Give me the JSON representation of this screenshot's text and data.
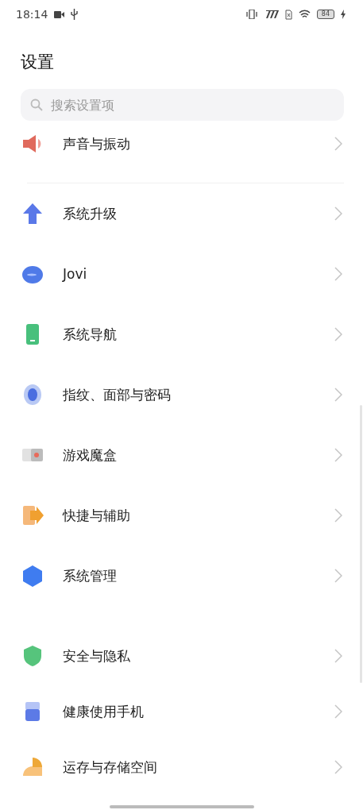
{
  "status_bar": {
    "time": "18:14",
    "battery": "84"
  },
  "title": "设置",
  "search": {
    "placeholder": "搜索设置项"
  },
  "groups": [
    {
      "items": [
        {
          "label": "声音与振动"
        }
      ]
    },
    {
      "items": [
        {
          "label": "系统升级"
        },
        {
          "label": "Jovi"
        },
        {
          "label": "系统导航"
        },
        {
          "label": "指纹、面部与密码"
        },
        {
          "label": "游戏魔盒"
        },
        {
          "label": "快捷与辅助"
        },
        {
          "label": "系统管理"
        }
      ]
    },
    {
      "items": [
        {
          "label": "安全与隐私"
        },
        {
          "label": "健康使用手机"
        },
        {
          "label": "运存与存储空间"
        }
      ]
    }
  ]
}
